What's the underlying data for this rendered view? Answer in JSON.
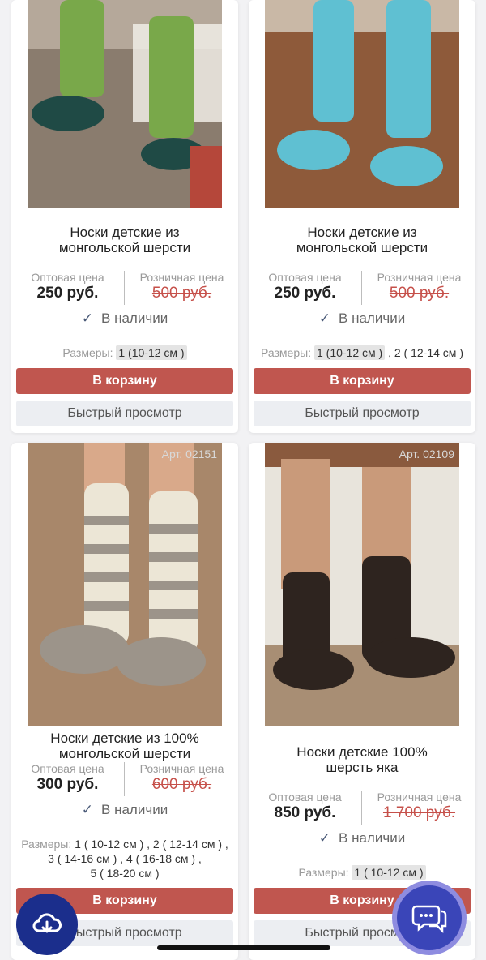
{
  "labels": {
    "wholesale": "Оптовая цена",
    "retail": "Розничная цена",
    "sizes_label": "Размеры:",
    "add_to_cart": "В корзину",
    "quick_view": "Быстрый просмотр",
    "in_stock": "В наличии"
  },
  "products": [
    {
      "title_line1": "Носки детские из",
      "title_line2": "монгольской шерсти",
      "wholesale_price": "250 руб.",
      "retail_price": "500 руб.",
      "sizes": [
        "1 (10-12 см )"
      ],
      "sock_color": "#79a84a",
      "toe_color": "#1f4a45"
    },
    {
      "title_line1": "Носки детские из",
      "title_line2": "монгольской шерсти",
      "wholesale_price": "250 руб.",
      "retail_price": "500 руб.",
      "sizes": [
        "1 (10-12 см )",
        "2 ( 12-14 см )"
      ],
      "sock_color": "#5fc0d2",
      "toe_color": "#5fc0d2"
    },
    {
      "article": "Арт. 02151",
      "title_line1": "Носки детские из 100%",
      "title_line2": "монгольской шерсти",
      "wholesale_price": "300 руб.",
      "retail_price": "600 руб.",
      "sizes_line1": "1 ( 10-12 см ) ,  2 ( 12-14 см ) ,",
      "sizes_line2": "3 ( 14-16 см ) ,  4 ( 16-18 см ) ,",
      "sizes_line3": "5 ( 18-20 см )",
      "sock_color": "#ece6d6",
      "toe_color": "#9c948a"
    },
    {
      "article": "Арт. 02109",
      "title_line1": "Носки детские 100%",
      "title_line2": "шерсть яка",
      "wholesale_price": "850 руб.",
      "retail_price": "1 700 руб.",
      "sizes": [
        "1 ( 10-12 см )"
      ],
      "sock_color": "#2e241f",
      "toe_color": "#2e241f"
    }
  ],
  "colors": {
    "accent_red": "#c0564f",
    "fab_cloud": "#1b2e8c",
    "fab_chat": "#3a45b8"
  }
}
